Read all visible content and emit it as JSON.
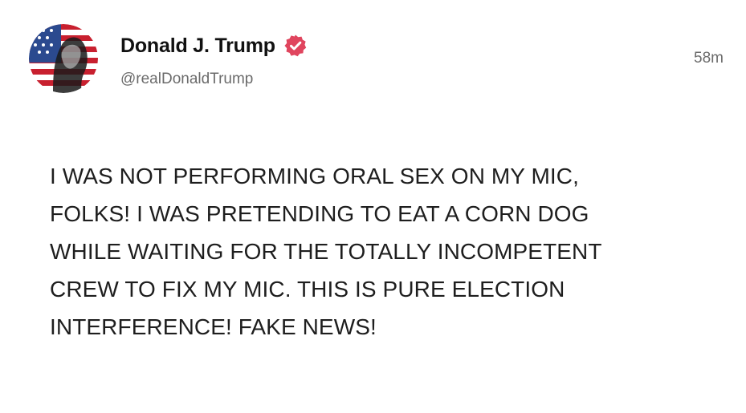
{
  "post": {
    "display_name": "Donald J. Trump",
    "handle": "@realDonaldTrump",
    "timestamp": "58m",
    "verified": true,
    "body": "I WAS NOT PERFORMING ORAL SEX ON MY MIC,\nFOLKS! I WAS PRETENDING TO EAT A CORN DOG\nWHILE WAITING FOR THE TOTALLY INCOMPETENT\nCREW TO FIX MY MIC. THIS IS PURE ELECTION\nINTERFERENCE! FAKE NEWS!"
  },
  "icons": {
    "avatar": "flag-portrait-avatar",
    "verified": "verified-badge-icon"
  },
  "colors": {
    "verified_badge": "#e0455e",
    "handle_text": "#6b6b6b",
    "body_text": "#1e1e1e"
  }
}
